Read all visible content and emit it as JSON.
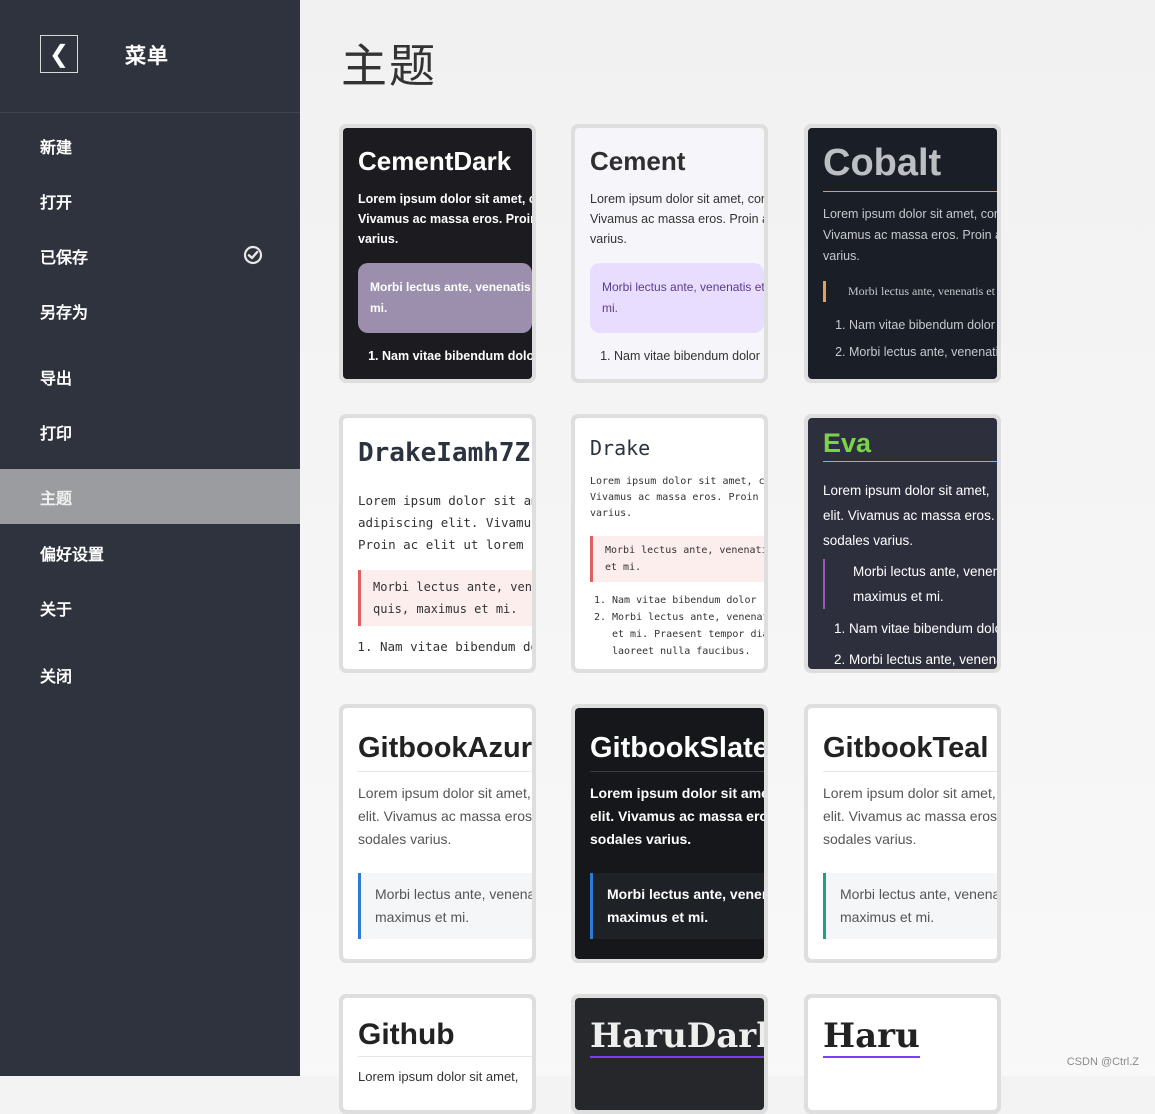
{
  "sidebar": {
    "back_glyph": "❮",
    "title": "菜单",
    "items": [
      {
        "label": "新建"
      },
      {
        "label": "打开"
      },
      {
        "label": "已保存",
        "checked": true
      },
      {
        "label": "另存为"
      },
      {
        "label": "导出"
      },
      {
        "label": "打印"
      },
      {
        "label": "主题",
        "active": true
      },
      {
        "label": "偏好设置"
      },
      {
        "label": "关于"
      },
      {
        "label": "关闭"
      }
    ]
  },
  "main": {
    "title": "主题",
    "themes": [
      {
        "name": "CementDark",
        "text": "Lorem ipsum dolor sit amet, consectetur",
        "text2": "Vivamus ac massa eros. Proin ac elit",
        "text3": "varius.",
        "quote": "Morbi lectus ante, venenatis et",
        "quote2": "mi.",
        "list": [
          "Nam vitae bibendum dolor"
        ]
      },
      {
        "name": "Cement",
        "text": "Lorem ipsum dolor sit amet, consectetur",
        "text2": "Vivamus ac massa eros. Proin ac elit",
        "text3": "varius.",
        "quote": "Morbi lectus ante, venenatis et",
        "quote2": "mi.",
        "list": [
          "Nam vitae bibendum dolor"
        ]
      },
      {
        "name": "Cobalt",
        "text": "Lorem ipsum dolor sit amet, consectetur",
        "text2": "Vivamus ac massa eros. Proin ac elit",
        "text3": "varius.",
        "quote": "Morbi lectus ante, venenatis et",
        "list": [
          "Nam vitae bibendum dolor",
          "Morbi lectus ante, venenatis"
        ]
      },
      {
        "name": "DrakeIamh7Z",
        "text": "Lorem ipsum dolor sit amet,",
        "text2": "adipiscing elit. Vivamus ac",
        "text3": "Proin ac elit ut lorem",
        "quote": "Morbi lectus ante, venenatis",
        "quote2": "quis, maximus et mi.",
        "list": [
          "Nam vitae bibendum dolor"
        ]
      },
      {
        "name": "Drake",
        "text": "Lorem ipsum dolor sit amet, consectetur",
        "text2": "Vivamus ac massa eros. Proin ac elit",
        "text3": "varius.",
        "quote": "Morbi lectus ante, venenatis et",
        "quote2": "et mi.",
        "list": [
          "Nam vitae bibendum dolor",
          "Morbi lectus ante, venenatis"
        ],
        "list_extra": [
          "et mi. Praesent tempor diam",
          "laoreet nulla faucibus."
        ]
      },
      {
        "name": "Eva",
        "text": "Lorem ipsum dolor sit amet,",
        "text2": "elit. Vivamus ac massa eros.",
        "text3": "sodales varius.",
        "quote": "Morbi lectus ante, venenatis",
        "quote2": "maximus et mi.",
        "list": [
          "Nam vitae bibendum dolor",
          "Morbi lectus ante, venenatis"
        ]
      },
      {
        "name": "GitbookAzure",
        "text": "Lorem ipsum dolor sit amet,",
        "text2": "elit. Vivamus ac massa eros.",
        "text3": "sodales varius.",
        "quote": "Morbi lectus ante, venenatis",
        "quote2": "maximus et mi."
      },
      {
        "name": "GitbookSlate",
        "text": "Lorem ipsum dolor sit amet,",
        "text2": "elit. Vivamus ac massa eros.",
        "text3": "sodales varius.",
        "quote": "Morbi lectus ante, venenatis",
        "quote2": "maximus et mi."
      },
      {
        "name": "GitbookTeal",
        "text": "Lorem ipsum dolor sit amet,",
        "text2": "elit. Vivamus ac massa eros.",
        "text3": "sodales varius.",
        "quote": "Morbi lectus ante, venenatis",
        "quote2": "maximus et mi."
      },
      {
        "name": "Github",
        "text": "Lorem ipsum dolor sit amet,"
      },
      {
        "name": "HaruDark"
      },
      {
        "name": "Haru"
      }
    ]
  },
  "watermark": "CSDN @Ctrl.Z",
  "colors": {
    "sidebar_bg": "#2e333d",
    "active_item_bg": "#9a9c9f",
    "eva_accent": "#7bd34c",
    "haru_accent": "#7b3ff2",
    "gitbook_azure": "#2d7bd6",
    "gitbook_teal": "#1ea08c"
  }
}
